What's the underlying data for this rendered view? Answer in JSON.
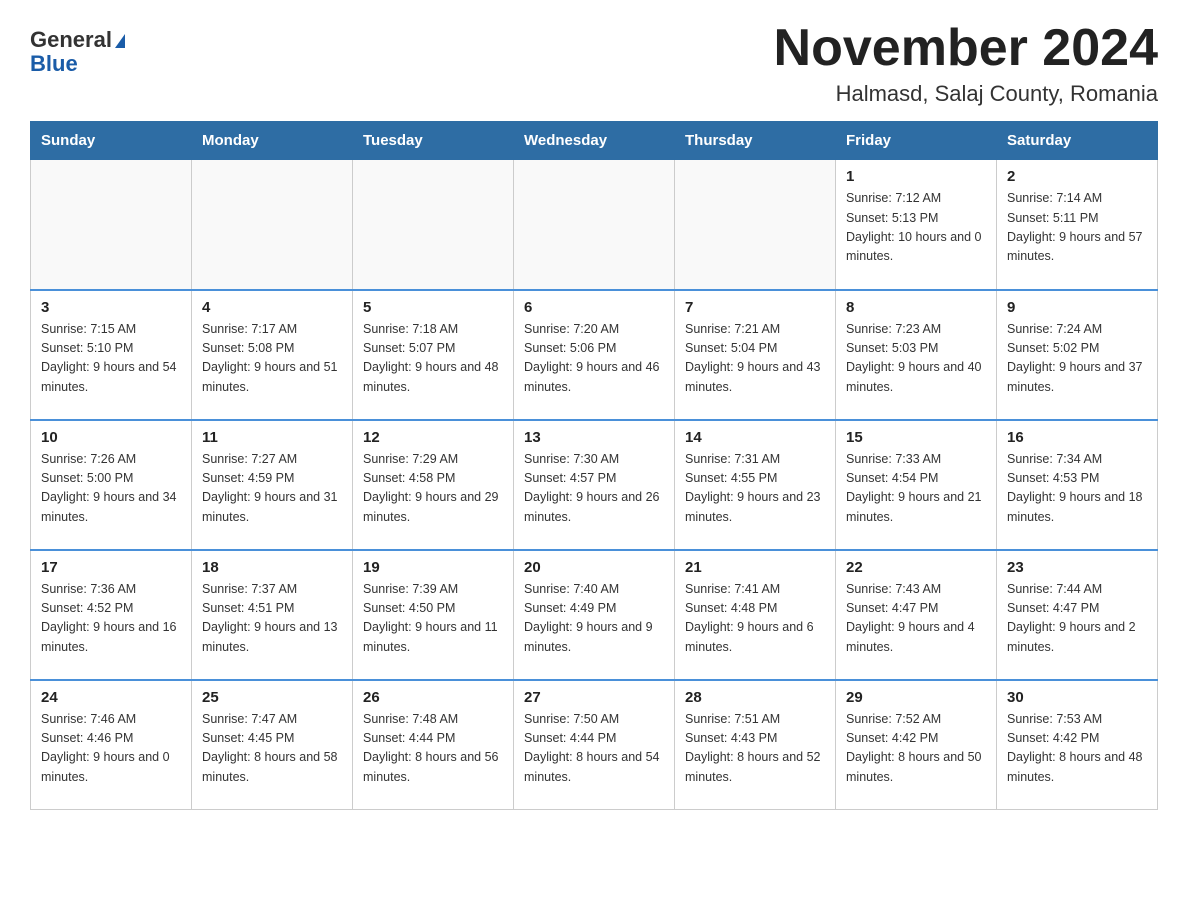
{
  "header": {
    "logo_general": "General",
    "logo_blue": "Blue",
    "title": "November 2024",
    "subtitle": "Halmasd, Salaj County, Romania"
  },
  "days_of_week": [
    "Sunday",
    "Monday",
    "Tuesday",
    "Wednesday",
    "Thursday",
    "Friday",
    "Saturday"
  ],
  "weeks": [
    [
      {
        "day": "",
        "info": ""
      },
      {
        "day": "",
        "info": ""
      },
      {
        "day": "",
        "info": ""
      },
      {
        "day": "",
        "info": ""
      },
      {
        "day": "",
        "info": ""
      },
      {
        "day": "1",
        "info": "Sunrise: 7:12 AM\nSunset: 5:13 PM\nDaylight: 10 hours and 0 minutes."
      },
      {
        "day": "2",
        "info": "Sunrise: 7:14 AM\nSunset: 5:11 PM\nDaylight: 9 hours and 57 minutes."
      }
    ],
    [
      {
        "day": "3",
        "info": "Sunrise: 7:15 AM\nSunset: 5:10 PM\nDaylight: 9 hours and 54 minutes."
      },
      {
        "day": "4",
        "info": "Sunrise: 7:17 AM\nSunset: 5:08 PM\nDaylight: 9 hours and 51 minutes."
      },
      {
        "day": "5",
        "info": "Sunrise: 7:18 AM\nSunset: 5:07 PM\nDaylight: 9 hours and 48 minutes."
      },
      {
        "day": "6",
        "info": "Sunrise: 7:20 AM\nSunset: 5:06 PM\nDaylight: 9 hours and 46 minutes."
      },
      {
        "day": "7",
        "info": "Sunrise: 7:21 AM\nSunset: 5:04 PM\nDaylight: 9 hours and 43 minutes."
      },
      {
        "day": "8",
        "info": "Sunrise: 7:23 AM\nSunset: 5:03 PM\nDaylight: 9 hours and 40 minutes."
      },
      {
        "day": "9",
        "info": "Sunrise: 7:24 AM\nSunset: 5:02 PM\nDaylight: 9 hours and 37 minutes."
      }
    ],
    [
      {
        "day": "10",
        "info": "Sunrise: 7:26 AM\nSunset: 5:00 PM\nDaylight: 9 hours and 34 minutes."
      },
      {
        "day": "11",
        "info": "Sunrise: 7:27 AM\nSunset: 4:59 PM\nDaylight: 9 hours and 31 minutes."
      },
      {
        "day": "12",
        "info": "Sunrise: 7:29 AM\nSunset: 4:58 PM\nDaylight: 9 hours and 29 minutes."
      },
      {
        "day": "13",
        "info": "Sunrise: 7:30 AM\nSunset: 4:57 PM\nDaylight: 9 hours and 26 minutes."
      },
      {
        "day": "14",
        "info": "Sunrise: 7:31 AM\nSunset: 4:55 PM\nDaylight: 9 hours and 23 minutes."
      },
      {
        "day": "15",
        "info": "Sunrise: 7:33 AM\nSunset: 4:54 PM\nDaylight: 9 hours and 21 minutes."
      },
      {
        "day": "16",
        "info": "Sunrise: 7:34 AM\nSunset: 4:53 PM\nDaylight: 9 hours and 18 minutes."
      }
    ],
    [
      {
        "day": "17",
        "info": "Sunrise: 7:36 AM\nSunset: 4:52 PM\nDaylight: 9 hours and 16 minutes."
      },
      {
        "day": "18",
        "info": "Sunrise: 7:37 AM\nSunset: 4:51 PM\nDaylight: 9 hours and 13 minutes."
      },
      {
        "day": "19",
        "info": "Sunrise: 7:39 AM\nSunset: 4:50 PM\nDaylight: 9 hours and 11 minutes."
      },
      {
        "day": "20",
        "info": "Sunrise: 7:40 AM\nSunset: 4:49 PM\nDaylight: 9 hours and 9 minutes."
      },
      {
        "day": "21",
        "info": "Sunrise: 7:41 AM\nSunset: 4:48 PM\nDaylight: 9 hours and 6 minutes."
      },
      {
        "day": "22",
        "info": "Sunrise: 7:43 AM\nSunset: 4:47 PM\nDaylight: 9 hours and 4 minutes."
      },
      {
        "day": "23",
        "info": "Sunrise: 7:44 AM\nSunset: 4:47 PM\nDaylight: 9 hours and 2 minutes."
      }
    ],
    [
      {
        "day": "24",
        "info": "Sunrise: 7:46 AM\nSunset: 4:46 PM\nDaylight: 9 hours and 0 minutes."
      },
      {
        "day": "25",
        "info": "Sunrise: 7:47 AM\nSunset: 4:45 PM\nDaylight: 8 hours and 58 minutes."
      },
      {
        "day": "26",
        "info": "Sunrise: 7:48 AM\nSunset: 4:44 PM\nDaylight: 8 hours and 56 minutes."
      },
      {
        "day": "27",
        "info": "Sunrise: 7:50 AM\nSunset: 4:44 PM\nDaylight: 8 hours and 54 minutes."
      },
      {
        "day": "28",
        "info": "Sunrise: 7:51 AM\nSunset: 4:43 PM\nDaylight: 8 hours and 52 minutes."
      },
      {
        "day": "29",
        "info": "Sunrise: 7:52 AM\nSunset: 4:42 PM\nDaylight: 8 hours and 50 minutes."
      },
      {
        "day": "30",
        "info": "Sunrise: 7:53 AM\nSunset: 4:42 PM\nDaylight: 8 hours and 48 minutes."
      }
    ]
  ]
}
